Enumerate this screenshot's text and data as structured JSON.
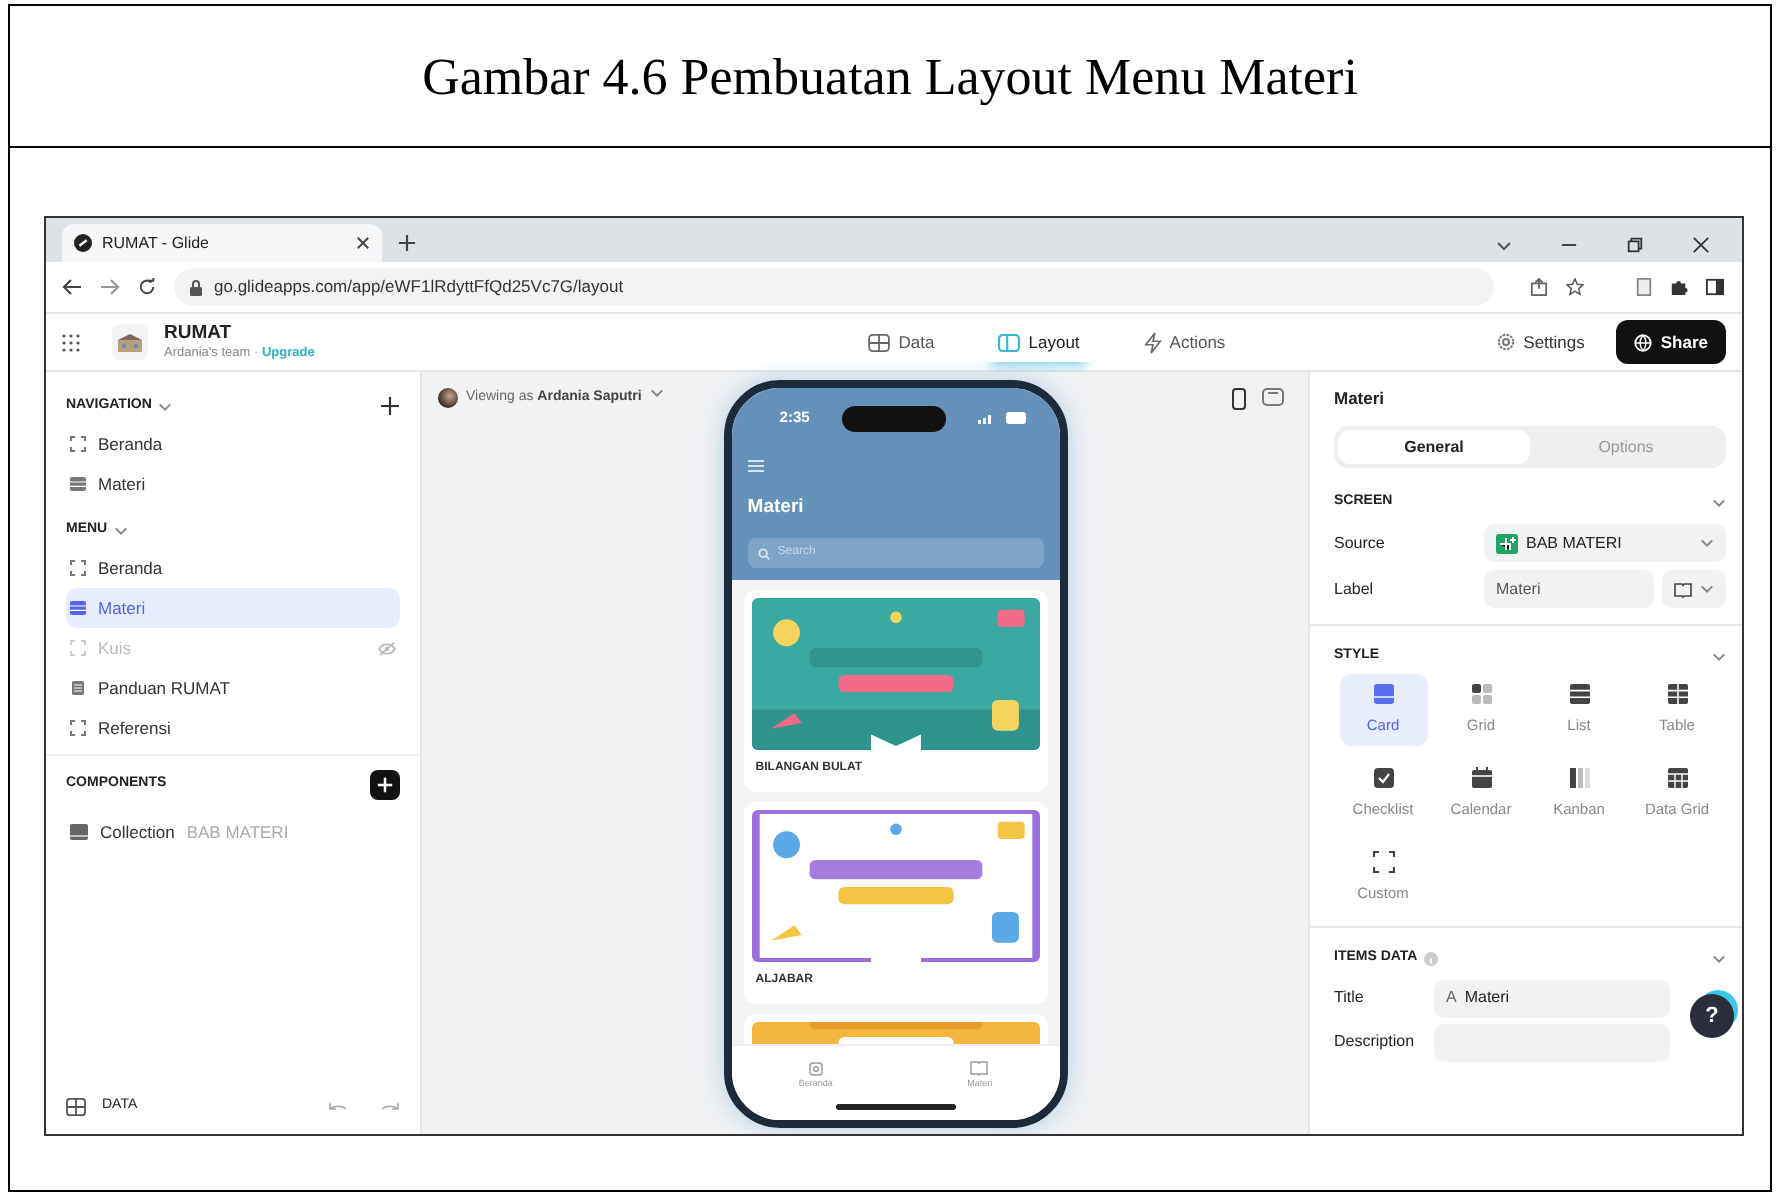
{
  "caption": "Gambar 4.6 Pembuatan Layout Menu Materi",
  "browser": {
    "tab_title": "RUMAT - Glide",
    "url": "go.glideapps.com/app/eWF1lRdyttFfQd25Vc7G/layout"
  },
  "app": {
    "name": "RUMAT",
    "team": "Ardania's team",
    "team_separator": "·",
    "upgrade": "Upgrade",
    "top_tabs": [
      {
        "label": "Data",
        "kind": "data",
        "selected": false
      },
      {
        "label": "Layout",
        "kind": "layout",
        "selected": true
      },
      {
        "label": "Actions",
        "kind": "actions",
        "selected": false
      }
    ],
    "settings": "Settings",
    "share": "Share"
  },
  "sidebar": {
    "navigation": {
      "title": "NAVIGATION",
      "items": [
        {
          "label": "Beranda",
          "kind": "custom",
          "selected": false,
          "hidden": false
        },
        {
          "label": "Materi",
          "kind": "list",
          "selected": false,
          "hidden": false
        }
      ]
    },
    "menu": {
      "title": "MENU",
      "items": [
        {
          "label": "Beranda",
          "kind": "custom",
          "selected": false,
          "hidden": false
        },
        {
          "label": "Materi",
          "kind": "list",
          "selected": true,
          "hidden": false
        },
        {
          "label": "Kuis",
          "kind": "custom",
          "selected": false,
          "hidden": true
        },
        {
          "label": "Panduan RUMAT",
          "kind": "doc",
          "selected": false,
          "hidden": false
        },
        {
          "label": "Referensi",
          "kind": "custom",
          "selected": false,
          "hidden": false
        }
      ]
    },
    "components": {
      "title": "COMPONENTS",
      "items": [
        {
          "label": "Collection",
          "source": "BAB MATERI"
        }
      ]
    },
    "footer": "DATA"
  },
  "canvas": {
    "viewing_prefix": "Viewing as",
    "viewing_user": "Ardania Saputri"
  },
  "phone": {
    "time": "2:35",
    "title": "Materi",
    "search_placeholder": "Search",
    "cards": [
      {
        "label": "BILANGAN BULAT",
        "kind": "picture"
      },
      {
        "label": "ALJABAR",
        "kind": "picture"
      },
      {
        "kind": "picture"
      }
    ],
    "tabs": [
      {
        "label": "Beranda",
        "kind": "home"
      },
      {
        "label": "Materi",
        "kind": "book"
      }
    ]
  },
  "panel": {
    "title": "Materi",
    "tabs": [
      {
        "label": "General",
        "selected": true
      },
      {
        "label": "Options",
        "selected": false
      }
    ],
    "screen": {
      "title": "SCREEN",
      "source_label": "Source",
      "source_value": "BAB MATERI",
      "label_label": "Label",
      "label_value": "Materi"
    },
    "style": {
      "title": "STYLE",
      "options": [
        {
          "label": "Card",
          "kind": "card",
          "selected": true
        },
        {
          "label": "Grid",
          "kind": "grid",
          "selected": false
        },
        {
          "label": "List",
          "kind": "list",
          "selected": false
        },
        {
          "label": "Table",
          "kind": "table",
          "selected": false
        },
        {
          "label": "Checklist",
          "kind": "checklist",
          "selected": false
        },
        {
          "label": "Calendar",
          "kind": "calendar",
          "selected": false
        },
        {
          "label": "Kanban",
          "kind": "kanban",
          "selected": false
        },
        {
          "label": "Data Grid",
          "kind": "datagrid",
          "selected": false
        },
        {
          "label": "Custom",
          "kind": "custom",
          "selected": false
        }
      ]
    },
    "items_data": {
      "title": "ITEMS DATA",
      "fields": [
        {
          "label": "Title",
          "type_mark": "A",
          "value": "Materi"
        },
        {
          "label": "Description"
        }
      ]
    },
    "help_button": "?"
  }
}
